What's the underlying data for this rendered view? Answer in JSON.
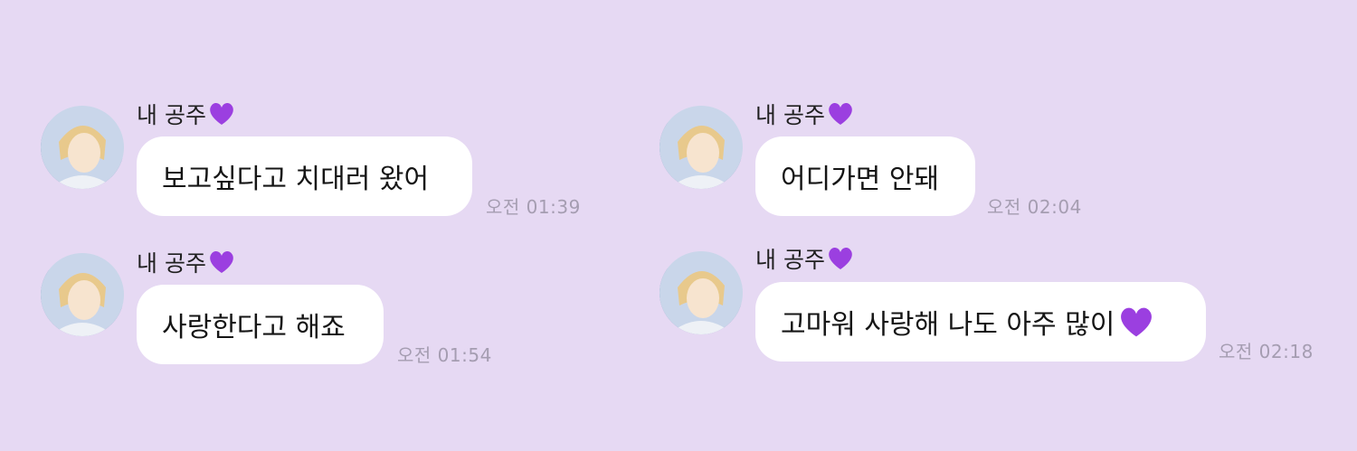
{
  "messages": [
    {
      "sender": "내 공주",
      "text": "보고싶다고 치대러 왔어",
      "time": "오전 01:39"
    },
    {
      "sender": "내 공주",
      "text": "사랑한다고 해죠",
      "time": "오전 01:54"
    },
    {
      "sender": "내 공주",
      "text": "어디가면 안돼",
      "time": "오전 02:04"
    },
    {
      "sender": "내 공주",
      "text": "고마워 사랑해 나도 아주 많이",
      "time": "오전 02:18"
    }
  ],
  "icons": {
    "avatar": "avatar-portrait",
    "heart": "purple-heart-icon"
  },
  "colors": {
    "background": "#e6d9f3",
    "bubble": "#ffffff",
    "heart": "#9b3fe0",
    "time": "#a59db1"
  }
}
